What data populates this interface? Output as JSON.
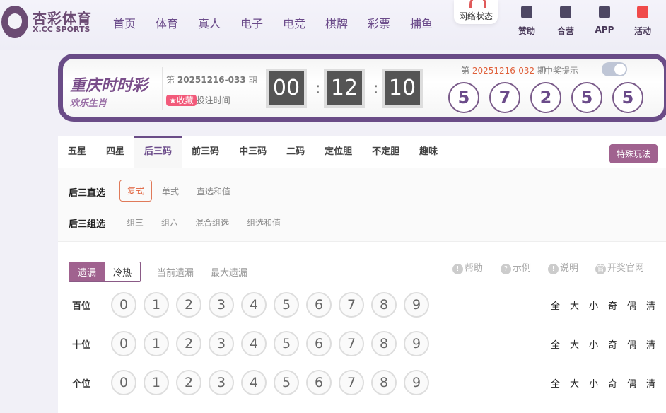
{
  "header": {
    "brand_cn": "杏彩体育",
    "brand_en": "X.CC SPORTS",
    "nav": [
      "首页",
      "体育",
      "真人",
      "电子",
      "电竞",
      "棋牌",
      "彩票",
      "捕鱼"
    ],
    "network_status": "网络状态",
    "tools": [
      {
        "label": "赞助",
        "icon": "bookmark-star-icon"
      },
      {
        "label": "合营",
        "icon": "handshake-icon"
      },
      {
        "label": "APP",
        "icon": "phone-icon"
      },
      {
        "label": "活动",
        "icon": "gift-icon"
      }
    ]
  },
  "lottery": {
    "logo_title": "重庆时时彩",
    "logo_sub": "欢乐生肖",
    "issue_prefix": "第",
    "current_issue": "20251216-033",
    "issue_suffix": "期",
    "favorite": "★收藏",
    "bet_time": "投注时间",
    "countdown": [
      "00",
      "12",
      "10"
    ],
    "last_issue": "20251216-032",
    "win_tip": "中奖提示",
    "win_tip_on": false,
    "last_numbers": [
      "5",
      "7",
      "2",
      "5",
      "5"
    ]
  },
  "tabs": {
    "items": [
      "五星",
      "四星",
      "后三码",
      "前三码",
      "中三码",
      "二码",
      "定位胆",
      "不定胆",
      "趣味"
    ],
    "active": "后三码",
    "special": "特殊玩法"
  },
  "subplays": [
    {
      "label": "后三直选",
      "options": [
        "复式",
        "单式",
        "直选和值"
      ],
      "selected": "复式"
    },
    {
      "label": "后三组选",
      "options": [
        "组三",
        "组六",
        "混合组选",
        "组选和值"
      ]
    }
  ],
  "stats": {
    "toggle": [
      "遗漏",
      "冷热"
    ],
    "active": "遗漏",
    "current_miss": "当前遗漏",
    "max_miss": "最大遗漏"
  },
  "help_links": [
    {
      "icon": "!",
      "label": "帮助"
    },
    {
      "icon": "?",
      "label": "示例"
    },
    {
      "icon": "!",
      "label": "说明"
    },
    {
      "icon": "官",
      "label": "开奖官网"
    }
  ],
  "rows": [
    {
      "label": "百位"
    },
    {
      "label": "十位"
    },
    {
      "label": "个位"
    }
  ],
  "digits": [
    "0",
    "1",
    "2",
    "3",
    "4",
    "5",
    "6",
    "7",
    "8",
    "9"
  ],
  "quick": [
    "全",
    "大",
    "小",
    "奇",
    "偶",
    "清"
  ],
  "colors": {
    "brand": "#6a4c87",
    "accent": "#a0628f",
    "highlight": "#e0603a"
  }
}
